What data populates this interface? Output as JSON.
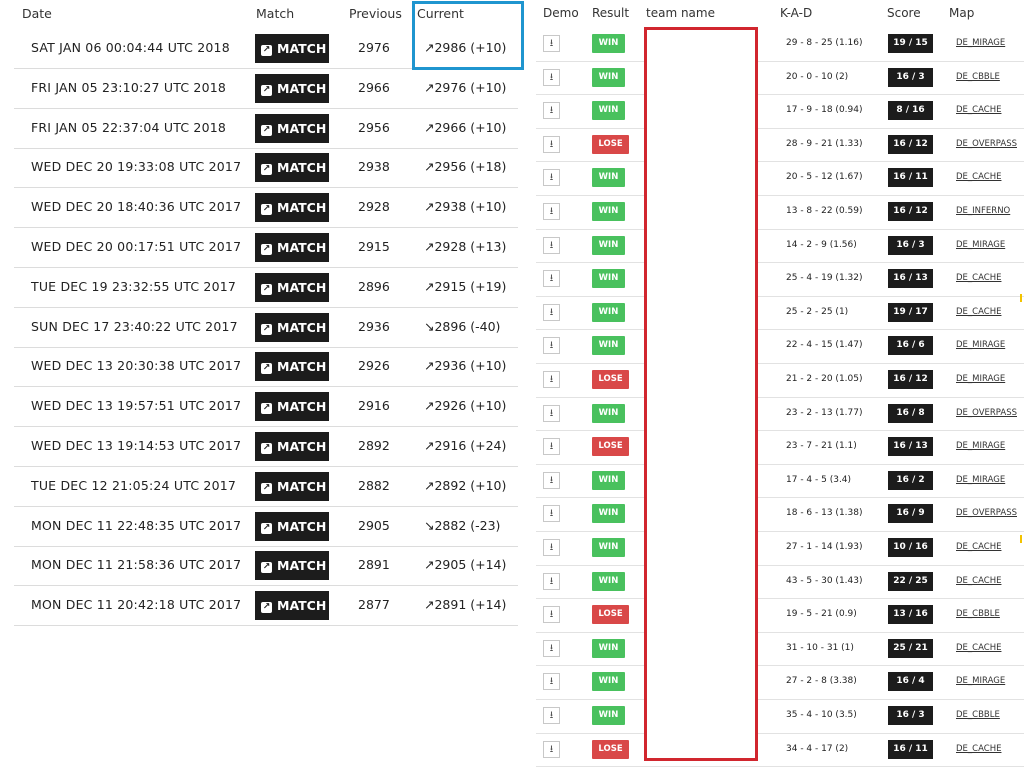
{
  "left_table": {
    "headers": {
      "date": "Date",
      "match": "Match",
      "previous": "Previous",
      "current": "Current"
    },
    "match_label": "MATCH",
    "rows": [
      {
        "date": "SAT JAN 06 00:04:44 UTC 2018",
        "previous": "2976",
        "current": "↗2986 (+10)"
      },
      {
        "date": "FRI JAN 05 23:10:27 UTC 2018",
        "previous": "2966",
        "current": "↗2976 (+10)"
      },
      {
        "date": "FRI JAN 05 22:37:04 UTC 2018",
        "previous": "2956",
        "current": "↗2966 (+10)"
      },
      {
        "date": "WED DEC 20 19:33:08 UTC 2017",
        "previous": "2938",
        "current": "↗2956 (+18)"
      },
      {
        "date": "WED DEC 20 18:40:36 UTC 2017",
        "previous": "2928",
        "current": "↗2938 (+10)"
      },
      {
        "date": "WED DEC 20 00:17:51 UTC 2017",
        "previous": "2915",
        "current": "↗2928 (+13)"
      },
      {
        "date": "TUE DEC 19 23:32:55 UTC 2017",
        "previous": "2896",
        "current": "↗2915 (+19)"
      },
      {
        "date": "SUN DEC 17 23:40:22 UTC 2017",
        "previous": "2936",
        "current": "↘2896 (-40)"
      },
      {
        "date": "WED DEC 13 20:30:38 UTC 2017",
        "previous": "2926",
        "current": "↗2936 (+10)"
      },
      {
        "date": "WED DEC 13 19:57:51 UTC 2017",
        "previous": "2916",
        "current": "↗2926 (+10)"
      },
      {
        "date": "WED DEC 13 19:14:53 UTC 2017",
        "previous": "2892",
        "current": "↗2916 (+24)"
      },
      {
        "date": "TUE DEC 12 21:05:24 UTC 2017",
        "previous": "2882",
        "current": "↗2892 (+10)"
      },
      {
        "date": "MON DEC 11 22:48:35 UTC 2017",
        "previous": "2905",
        "current": "↘2882 (-23)"
      },
      {
        "date": "MON DEC 11 21:58:36 UTC 2017",
        "previous": "2891",
        "current": "↗2905 (+14)"
      },
      {
        "date": "MON DEC 11 20:42:18 UTC 2017",
        "previous": "2877",
        "current": "↗2891 (+14)"
      }
    ]
  },
  "right_table": {
    "headers": {
      "demo": "Demo",
      "result": "Result",
      "team": "team name",
      "kad": "K-A-D",
      "score": "Score",
      "map": "Map"
    },
    "rows": [
      {
        "result": "WIN",
        "kad": "29 - 8 - 25 (1.16)",
        "score": "19 / 15",
        "map": "DE_MIRAGE"
      },
      {
        "result": "WIN",
        "kad": "20 - 0 - 10 (2)",
        "score": "16 / 3",
        "map": "DE_CBBLE"
      },
      {
        "result": "WIN",
        "kad": "17 - 9 - 18 (0.94)",
        "score": "8 / 16",
        "map": "DE_CACHE"
      },
      {
        "result": "LOSE",
        "kad": "28 - 9 - 21 (1.33)",
        "score": "16 / 12",
        "map": "DE_OVERPASS"
      },
      {
        "result": "WIN",
        "kad": "20 - 5 - 12 (1.67)",
        "score": "16 / 11",
        "map": "DE_CACHE"
      },
      {
        "result": "WIN",
        "kad": "13 - 8 - 22 (0.59)",
        "score": "16 / 12",
        "map": "DE_INFERNO"
      },
      {
        "result": "WIN",
        "kad": "14 - 2 - 9 (1.56)",
        "score": "16 / 3",
        "map": "DE_MIRAGE"
      },
      {
        "result": "WIN",
        "kad": "25 - 4 - 19 (1.32)",
        "score": "16 / 13",
        "map": "DE_CACHE"
      },
      {
        "result": "WIN",
        "kad": "25 - 2 - 25 (1)",
        "score": "19 / 17",
        "map": "DE_CACHE"
      },
      {
        "result": "WIN",
        "kad": "22 - 4 - 15 (1.47)",
        "score": "16 / 6",
        "map": "DE_MIRAGE"
      },
      {
        "result": "LOSE",
        "kad": "21 - 2 - 20 (1.05)",
        "score": "16 / 12",
        "map": "DE_MIRAGE"
      },
      {
        "result": "WIN",
        "kad": "23 - 2 - 13 (1.77)",
        "score": "16 / 8",
        "map": "DE_OVERPASS"
      },
      {
        "result": "LOSE",
        "kad": "23 - 7 - 21 (1.1)",
        "score": "16 / 13",
        "map": "DE_MIRAGE"
      },
      {
        "result": "WIN",
        "kad": "17 - 4 - 5 (3.4)",
        "score": "16 / 2",
        "map": "DE_MIRAGE"
      },
      {
        "result": "WIN",
        "kad": "18 - 6 - 13 (1.38)",
        "score": "16 / 9",
        "map": "DE_OVERPASS"
      },
      {
        "result": "WIN",
        "kad": "27 - 1 - 14 (1.93)",
        "score": "10 / 16",
        "map": "DE_CACHE"
      },
      {
        "result": "WIN",
        "kad": "43 - 5 - 30 (1.43)",
        "score": "22 / 25",
        "map": "DE_CACHE"
      },
      {
        "result": "LOSE",
        "kad": "19 - 5 - 21 (0.9)",
        "score": "13 / 16",
        "map": "DE_CBBLE"
      },
      {
        "result": "WIN",
        "kad": "31 - 10 - 31 (1)",
        "score": "25 / 21",
        "map": "DE_CACHE"
      },
      {
        "result": "WIN",
        "kad": "27 - 2 - 8 (3.38)",
        "score": "16 / 4",
        "map": "DE_MIRAGE"
      },
      {
        "result": "WIN",
        "kad": "35 - 4 - 10 (3.5)",
        "score": "16 / 3",
        "map": "DE_CBBLE"
      },
      {
        "result": "LOSE",
        "kad": "34 - 4 - 17 (2)",
        "score": "16 / 11",
        "map": "DE_CACHE"
      }
    ]
  },
  "highlight_colors": {
    "current_box": "#1f95cf",
    "team_box": "#d1262e",
    "win": "#49c15e",
    "lose": "#d94848"
  }
}
